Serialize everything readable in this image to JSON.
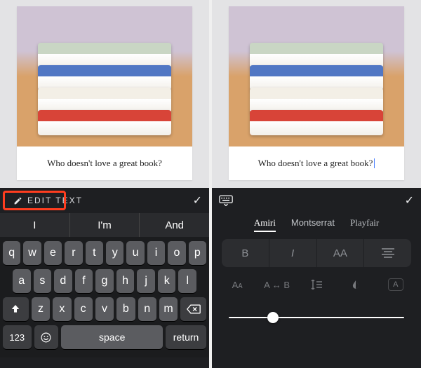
{
  "caption": "Who doesn't love a great book?",
  "left": {
    "edit_label": "EDIT TEXT",
    "suggestions": [
      "I",
      "I'm",
      "And"
    ],
    "keyboard": {
      "row1": [
        "q",
        "w",
        "e",
        "r",
        "t",
        "y",
        "u",
        "i",
        "o",
        "p"
      ],
      "row2": [
        "a",
        "s",
        "d",
        "f",
        "g",
        "h",
        "j",
        "k",
        "l"
      ],
      "row3": [
        "z",
        "x",
        "c",
        "v",
        "b",
        "n",
        "m"
      ],
      "numbers": "123",
      "space": "space",
      "return": "return"
    }
  },
  "right": {
    "fonts": {
      "f0": "Amiri",
      "f1": "Montserrat",
      "f2": "Playfair"
    },
    "style": {
      "bold": "B",
      "italic": "I",
      "caps": "AA"
    },
    "adv": {
      "size": "Aᴀ",
      "kerning": "A ↔ B"
    },
    "slider_value": 0.22
  }
}
